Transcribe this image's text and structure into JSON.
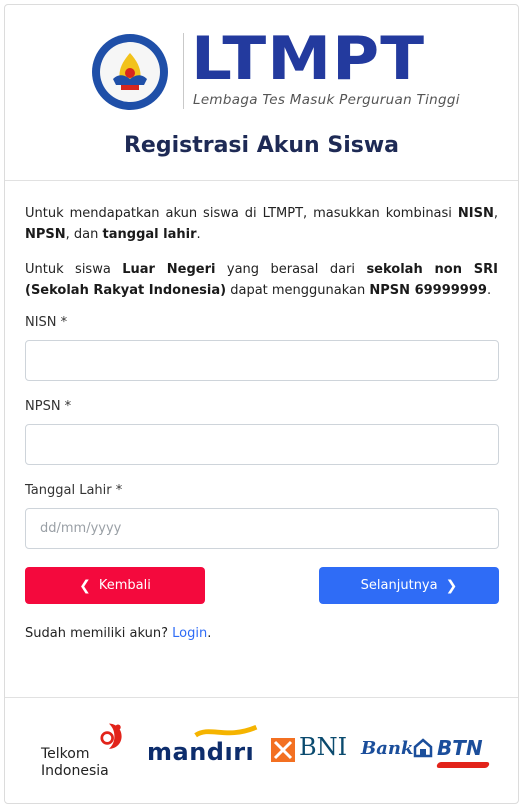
{
  "header": {
    "brand": "LTMPT",
    "brand_subtitle": "Lembaga Tes Masuk Perguruan Tinggi",
    "emblem_text": "TUT WURI HANDAYANI",
    "title": "Registrasi Akun Siswa"
  },
  "intro": {
    "p1_a": "Untuk mendapatkan akun siswa di LTMPT, masukkan kombinasi ",
    "p1_nisn": "NISN",
    "p1_b": ", ",
    "p1_npsn": "NPSN",
    "p1_c": ", dan ",
    "p1_tgl": "tanggal lahir",
    "p1_d": ".",
    "p2_a": "Untuk siswa ",
    "p2_ln": "Luar Negeri",
    "p2_b": " yang berasal dari ",
    "p2_sri": "sekolah non SRI (Sekolah Rakyat Indonesia)",
    "p2_c": " dapat menggunakan ",
    "p2_npsn": "NPSN 69999999",
    "p2_d": "."
  },
  "form": {
    "nisn_label": "NISN *",
    "nisn_value": "",
    "npsn_label": "NPSN *",
    "npsn_value": "",
    "dob_label": "Tanggal Lahir *",
    "dob_placeholder": "dd/mm/yyyy"
  },
  "buttons": {
    "back_label": "Kembali",
    "next_label": "Selanjutnya"
  },
  "login": {
    "prompt": "Sudah memiliki akun? ",
    "link": "Login",
    "suffix": "."
  },
  "sponsors": {
    "telkom_line1": "Telkom",
    "telkom_line2": "Indonesia",
    "mandiri": "mandırı",
    "bni": "BNI",
    "btn_bank": "Bank",
    "btn": "BTN"
  },
  "colors": {
    "brand_blue": "#233a9e",
    "back_red": "#f4093d",
    "next_blue": "#2f6cf6"
  }
}
